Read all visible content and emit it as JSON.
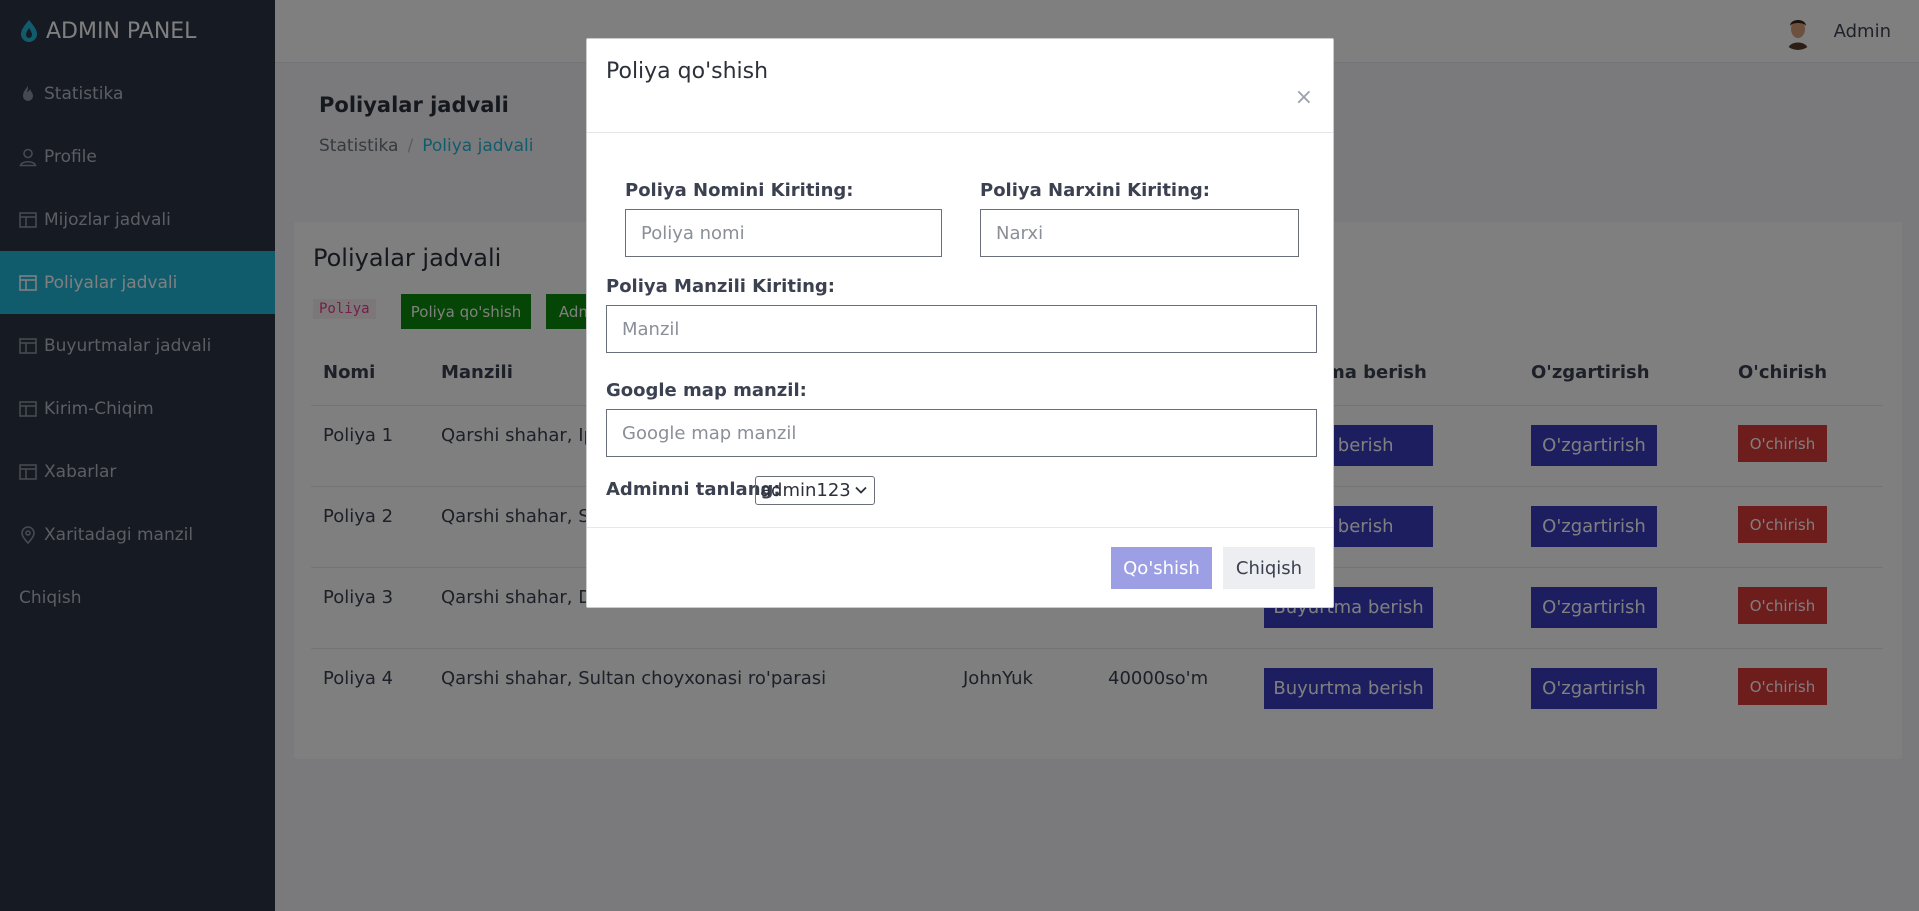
{
  "brand": {
    "title": "ADMIN PANEL"
  },
  "sidebar": {
    "items": [
      {
        "label": "Statistika",
        "icon": "fire-icon"
      },
      {
        "label": "Profile",
        "icon": "user-icon"
      },
      {
        "label": "Mijozlar jadvali",
        "icon": "table-icon"
      },
      {
        "label": "Poliyalar jadvali",
        "icon": "table-icon",
        "active": true
      },
      {
        "label": "Buyurtmalar jadvali",
        "icon": "table-icon"
      },
      {
        "label": "Kirim-Chiqim",
        "icon": "table-icon"
      },
      {
        "label": "Xabarlar",
        "icon": "table-icon"
      },
      {
        "label": "Xaritadagi manzil",
        "icon": "map-pin-icon"
      },
      {
        "label": "Chiqish"
      }
    ]
  },
  "topbar": {
    "user_name": "Admin"
  },
  "page": {
    "title": "Poliyalar jadvali",
    "breadcrumb": [
      "Statistika",
      "Poliya jadvali"
    ]
  },
  "card": {
    "title": "Poliyalar jadvali",
    "tag": "Poliya",
    "add_button": "Poliya qo'shish",
    "admin_button": "Adm"
  },
  "table": {
    "headers": [
      "Nomi",
      "Manzili",
      "ma berish",
      "O'zgartirish",
      "O'chirish"
    ],
    "rows": [
      {
        "name": "Poliya 1",
        "address": "Qarshi shahar, Ipo",
        "admin": "",
        "price": "",
        "order": "ma berish",
        "edit": "O'zgartirish",
        "delete": "O'chirish"
      },
      {
        "name": "Poliya 2",
        "address": "Qarshi shahar, Sif",
        "admin": "",
        "price": "",
        "order": "ma berish",
        "edit": "O'zgartirish",
        "delete": "O'chirish"
      },
      {
        "name": "Poliya 3",
        "address": "Qarshi shahar, De",
        "admin": "",
        "price": "",
        "order": "Buyurtma berish",
        "edit": "O'zgartirish",
        "delete": "O'chirish"
      },
      {
        "name": "Poliya 4",
        "address": "Qarshi shahar, Sultan choyxonasi ro'parasi",
        "admin": "JohnYuk",
        "price": "40000so'm",
        "order": "Buyurtma berish",
        "edit": "O'zgartirish",
        "delete": "O'chirish"
      }
    ]
  },
  "modal": {
    "title": "Poliya qo'shish",
    "close": "×",
    "name_label": "Poliya Nomini Kiriting:",
    "name_placeholder": "Poliya nomi",
    "price_label": "Poliya Narxini Kiriting:",
    "price_placeholder": "Narxi",
    "address_label": "Poliya Manzili Kiriting:",
    "address_placeholder": "Manzil",
    "map_label": "Google map manzil:",
    "map_placeholder": "Google map manzil",
    "admin_label": "Adminni tanlang:",
    "admin_selected": "admin123",
    "submit": "Qo'shish",
    "cancel": "Chiqish"
  },
  "colors": {
    "sidebar_bg": "#2c3446",
    "active": "#23b8d9",
    "primary": "#3a3dbf",
    "danger": "#dc3b3b",
    "success": "#0a8a0a"
  }
}
